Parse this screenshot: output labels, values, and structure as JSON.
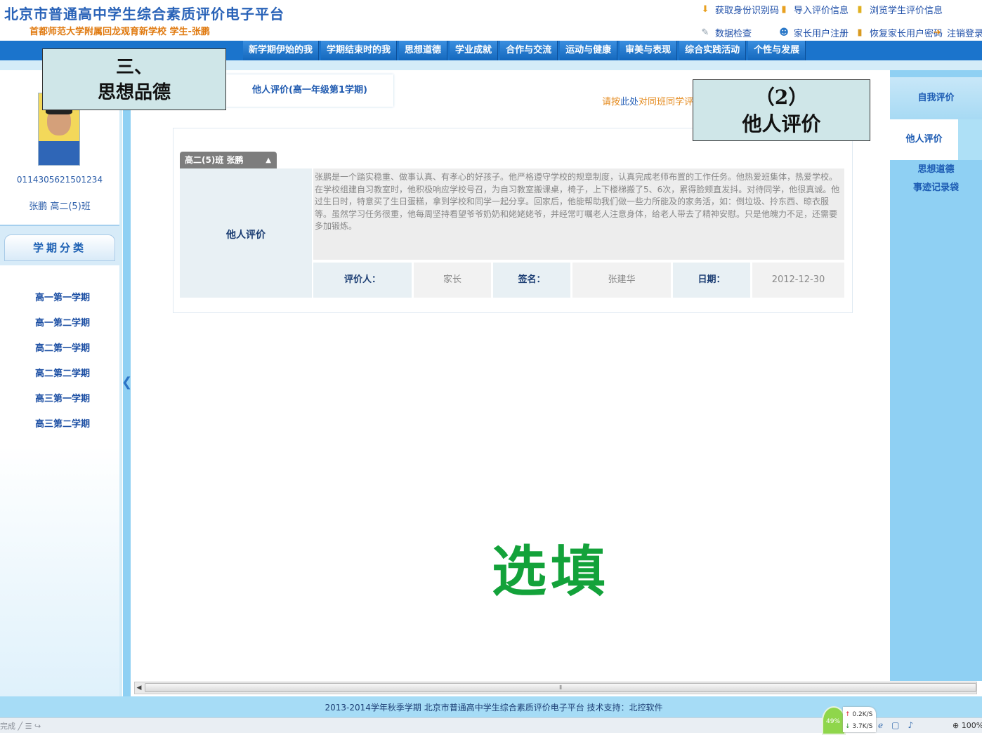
{
  "header": {
    "site_title": "北京市普通高中学生综合素质评价电子平台",
    "school_student": "首都师范大学附属回龙观育新学校 学生-张鹏",
    "top_links_row1": [
      "获取身份识别码",
      "导入评价信息",
      "浏览学生评价信息"
    ],
    "top_links_row2": [
      "数据检查",
      "家长用户注册",
      "恢复家长用户密码",
      "注销登录"
    ]
  },
  "nav": {
    "items": [
      "新学期伊始的我",
      "学期结束时的我",
      "思想道德",
      "学业成就",
      "合作与交流",
      "运动与健康",
      "审美与表现",
      "综合实践活动",
      "个性与发展"
    ]
  },
  "student": {
    "id": "0114305621501234",
    "class_line": "张鹏 高二(5)班"
  },
  "terms": {
    "header": "学期分类",
    "items": [
      "高一第一学期",
      "高一第二学期",
      "高二第一学期",
      "高二第二学期",
      "高三第一学期",
      "高三第二学期"
    ]
  },
  "main": {
    "tab_other": "他人评价(高一年级第1学期)",
    "peer_link_pre": "请按",
    "peer_link_here": "此处",
    "peer_link_post": "对同班同学评价",
    "class_tab": "高二(5)班 张鹏",
    "eval_label": "他人评价",
    "eval_text": "张鹏是一个踏实稳重、做事认真、有孝心的好孩子。他严格遵守学校的规章制度，认真完成老师布置的工作任务。他热爱班集体，热爱学校。在学校组建自习教室时，他积极响应学校号召，为自习教室搬课桌，椅子，上下楼梯搬了5、6次，累得脸颊直发抖。对待同学，他很真诚。他过生日时，特意买了生日蛋糕，拿到学校和同学一起分享。回家后，他能帮助我们做一些力所能及的家务活，如：倒垃圾、拎东西、晾衣服等。虽然学习任务很重，他每周坚持看望爷爷奶奶和姥姥姥爷，并经常叮嘱老人注意身体，给老人带去了精神安慰。只是他魄力不足，还需要多加锻炼。",
    "evaluator_key": "评价人：",
    "evaluator_val": "家长",
    "signature_key": "签名：",
    "signature_val": "张建华",
    "date_key": "日期：",
    "date_val": "2012-12-30"
  },
  "right_panel": {
    "self_eval": "自我评价",
    "other_eval": "他人评价",
    "link_moral": "思想道德",
    "link_records": "事迹记录袋"
  },
  "callouts": {
    "left_line1": "三、",
    "left_line2": "思想品德",
    "right_line1": "（2）",
    "right_line2": "他人评价",
    "optional": "选填"
  },
  "footer": {
    "text": "2013-2014学年秋季学期 北京市普通高中学生综合素质评价电子平台 技术支持：北控软件"
  },
  "statusbar": {
    "left_text": "完成",
    "speed_percent": "49%",
    "speed_up": "0.2K/S",
    "speed_down": "3.7K/S",
    "zoom": "100%"
  },
  "colors": {
    "nav_blue": "#1b74cc",
    "panel_blue": "#8fd0f3",
    "callout_bg": "#cfe6e8",
    "optional_green": "#13a23a",
    "link_orange": "#e48a1d"
  }
}
